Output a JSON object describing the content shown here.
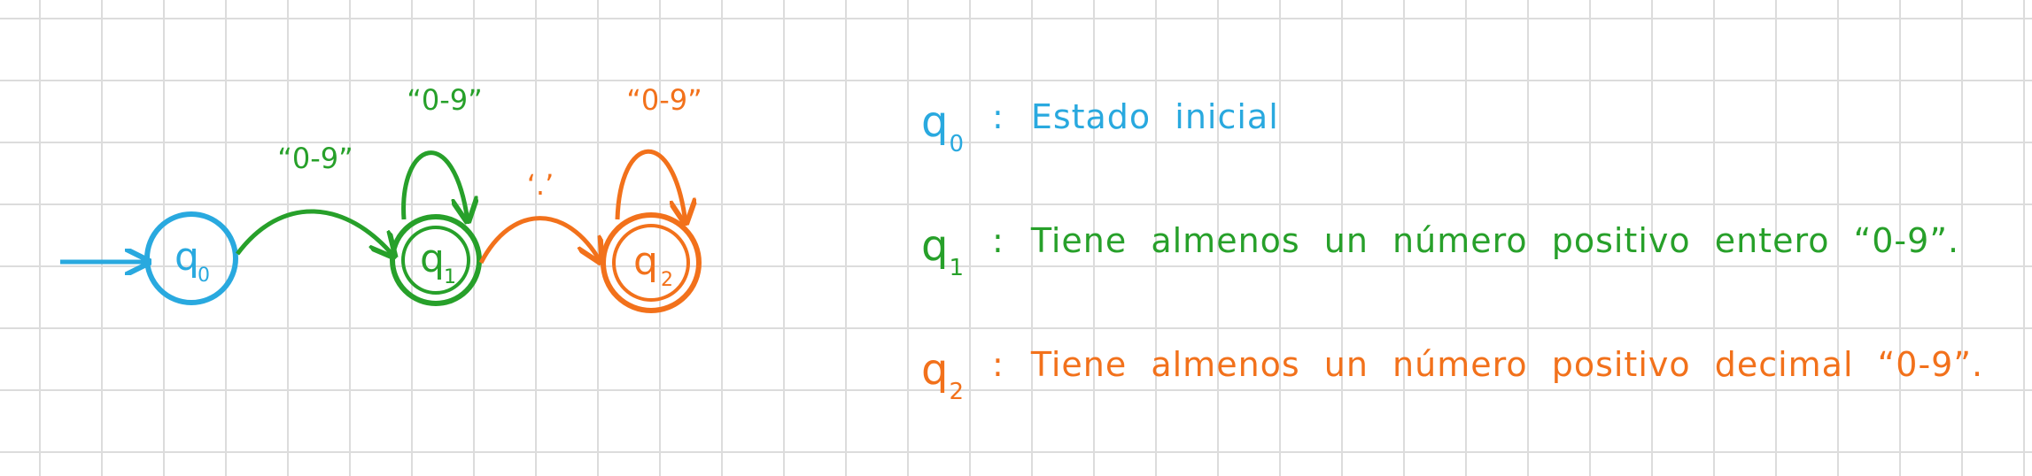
{
  "colors": {
    "q0": "#29a9df",
    "q1": "#27a02a",
    "q2": "#f2711b"
  },
  "automaton": {
    "states": [
      {
        "id": "q0",
        "base": "q",
        "sub": "0"
      },
      {
        "id": "q1",
        "base": "q",
        "sub": "1"
      },
      {
        "id": "q2",
        "base": "q",
        "sub": "2"
      }
    ],
    "transitions": [
      {
        "from": "q0",
        "to": "q1",
        "label": "“0-9”"
      },
      {
        "from": "q1",
        "to": "q1",
        "label": "“0-9”"
      },
      {
        "from": "q1",
        "to": "q2",
        "label": "‘.’"
      },
      {
        "from": "q2",
        "to": "q2",
        "label": "“0-9”"
      }
    ]
  },
  "legend": [
    {
      "base": "q",
      "sub": "0",
      "sep": ":",
      "text": "Estado inicial"
    },
    {
      "base": "q",
      "sub": "1",
      "sep": ":",
      "text": "Tiene almenos un número positivo entero “0-9”."
    },
    {
      "base": "q",
      "sub": "2",
      "sep": ":",
      "text": "Tiene almenos un número positivo decimal “0-9”."
    }
  ]
}
